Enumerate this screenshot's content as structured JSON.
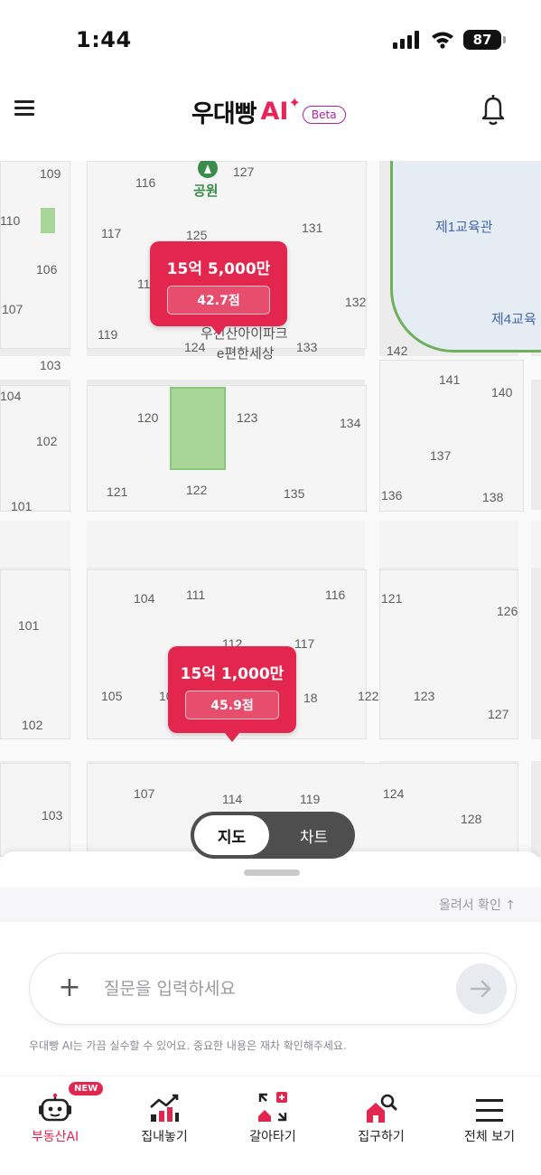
{
  "status_bar": {
    "time": "1:44",
    "battery": "87"
  },
  "header": {
    "logo_text": "우대빵",
    "logo_ai": "AI",
    "beta": "Beta"
  },
  "map": {
    "park_label": "공원",
    "school_labels": [
      "제1교육관",
      "제4교육"
    ],
    "complex_name_line1": "우신산아이파크",
    "complex_name_line2": "e편한세상",
    "building_numbers_top": [
      "109",
      "116",
      "127",
      "110",
      "117",
      "125",
      "131",
      "106",
      "11",
      "132",
      "107",
      "119",
      "124",
      "133",
      "142",
      "103",
      "141",
      "140",
      "104",
      "120",
      "123",
      "134",
      "102",
      "137",
      "101",
      "121",
      "122",
      "135",
      "136",
      "138"
    ],
    "building_numbers_bottom": [
      "104",
      "111",
      "116",
      "121",
      "126",
      "101",
      "112",
      "117",
      "105",
      "10",
      "18",
      "122",
      "123",
      "102",
      "127",
      "107",
      "114",
      "119",
      "124",
      "103",
      "128"
    ],
    "markers": [
      {
        "price": "15억 5,000만",
        "score": "42.7점"
      },
      {
        "price": "15억 1,000만",
        "score": "45.9점"
      }
    ],
    "toggle": {
      "map_label": "지도",
      "chart_label": "차트"
    }
  },
  "sheet": {
    "scroll_hint": "올려서 확인 ↑",
    "input_placeholder": "질문을 입력하세요",
    "disclaimer": "우대빵 AI는 가끔 실수할 수 있어요. 중요한 내용은 재차 확인해주세요."
  },
  "bottom_nav": {
    "items": [
      {
        "label": "부동산AI",
        "badge": "NEW",
        "icon": "robot-icon"
      },
      {
        "label": "집내놓기",
        "icon": "house-chart-icon"
      },
      {
        "label": "갈아타기",
        "icon": "house-swap-icon"
      },
      {
        "label": "집구하기",
        "icon": "house-search-icon"
      },
      {
        "label": "전체 보기",
        "icon": "menu-icon"
      }
    ]
  },
  "colors": {
    "accent": "#e2264e",
    "beta": "#b21fa0",
    "park": "#3a8c4a",
    "school": "#4466aa"
  }
}
